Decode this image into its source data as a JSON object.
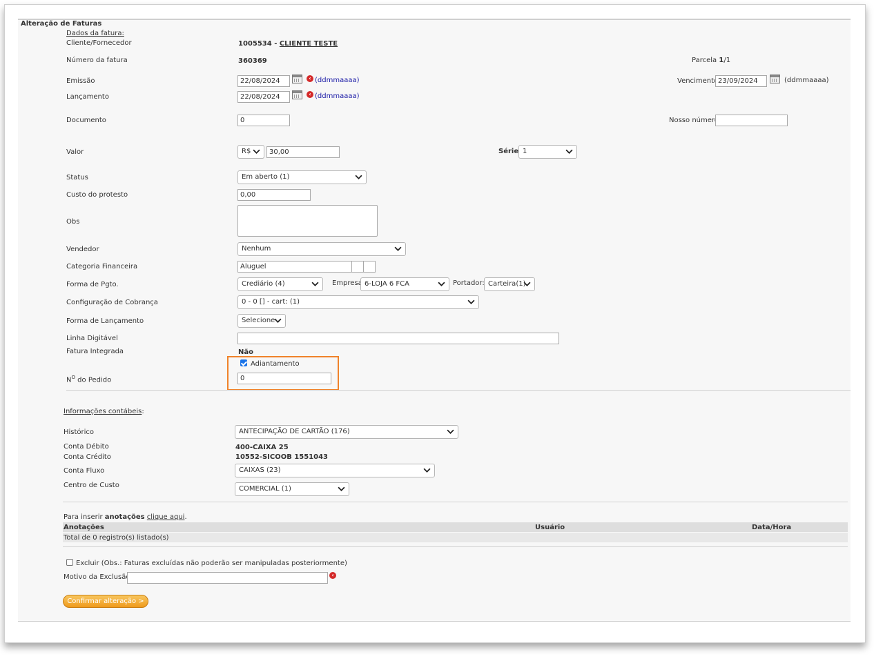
{
  "page_title": "Alteração de Faturas",
  "section_fatura": "Dados da fatura:",
  "cliente": {
    "label": "Cliente/Fornecedor",
    "code": "1005534",
    "sep": " - ",
    "name": "CLIENTE TESTE"
  },
  "numero": {
    "label": "Número da fatura",
    "value": "360369"
  },
  "parcela": {
    "label": "Parcela",
    "value": "1",
    "total": "/1"
  },
  "emissao": {
    "label": "Emissão",
    "value": "22/08/2024",
    "hint": "(ddmmaaaa)"
  },
  "lancamento": {
    "label": "Lançamento",
    "value": "22/08/2024",
    "hint": "(ddmmaaaa)"
  },
  "vencimento": {
    "label": "Vencimento",
    "value": "23/09/2024",
    "hint": "(ddmmaaaa)"
  },
  "documento": {
    "label": "Documento",
    "value": "0"
  },
  "nosso_numero": {
    "label": "Nosso número",
    "value": ""
  },
  "valor": {
    "label": "Valor",
    "currency": "R$",
    "value": "30,00"
  },
  "serie": {
    "label": "Série",
    "value": "1"
  },
  "status": {
    "label": "Status",
    "value": "Em aberto (1)"
  },
  "custo_protesto": {
    "label": "Custo do protesto",
    "value": "0,00"
  },
  "obs": {
    "label": "Obs",
    "value": ""
  },
  "vendedor": {
    "label": "Vendedor",
    "value": "Nenhum"
  },
  "categoria": {
    "label": "Categoria Financeira",
    "value": "Aluguel"
  },
  "forma_pgto": {
    "label": "Forma de Pgto.",
    "value": "Crediário (4)"
  },
  "empresa": {
    "label": "Empresa",
    "value": "6-LOJA 6 FCA"
  },
  "portador": {
    "label": "Portador:",
    "value": "Carteira(1)"
  },
  "config_cobranca": {
    "label": "Configuração de Cobrança",
    "value": "0 - 0 [] - cart: (1)"
  },
  "forma_lancamento": {
    "label": "Forma de Lançamento",
    "value": "Selecione"
  },
  "linha_digitavel": {
    "label": "Linha Digitável",
    "value": ""
  },
  "fatura_integrada": {
    "label": "Fatura Integrada",
    "value": "Não"
  },
  "adiantamento": {
    "label": "Adiantamento",
    "checked": true
  },
  "pedido": {
    "label_prefix": "N",
    "label_sup": "O",
    "label_suffix": " do Pedido",
    "value": "0"
  },
  "section_contabeis": "Informações contábeis",
  "section_contabeis_colon": ":",
  "historico": {
    "label": "Histórico",
    "value": "ANTECIPAÇÃO DE CARTÃO (176)"
  },
  "conta_debito": {
    "label": "Conta Débito",
    "value": "400-CAIXA 25"
  },
  "conta_credito": {
    "label": "Conta Crédito",
    "value": "10552-SICOOB 1551043"
  },
  "conta_fluxo": {
    "label": "Conta Fluxo",
    "value": "CAIXAS (23)"
  },
  "centro_custo": {
    "label": "Centro de Custo",
    "value": "COMERCIAL (1)"
  },
  "anotacoes": {
    "intro": "Para inserir ",
    "intro_bold": "anotações",
    "link": "clique aqui",
    "dot": ".",
    "columns": [
      "Anotações",
      "Usuário",
      "Data/Hora"
    ],
    "total": "Total de 0 registro(s) listado(s)"
  },
  "excluir": {
    "label": "Excluir (Obs.: Faturas excluídas não poderão ser manipuladas posteriormente)",
    "checked": false
  },
  "motivo": {
    "label": "Motivo da Exclusão:",
    "value": ""
  },
  "confirm_button": "Confirmar alteração >",
  "colors": {
    "accent_orange": "#f0822a",
    "button": "#ef9a1c",
    "link": "#1a1aa6",
    "remove_red": "#d42a2a"
  }
}
